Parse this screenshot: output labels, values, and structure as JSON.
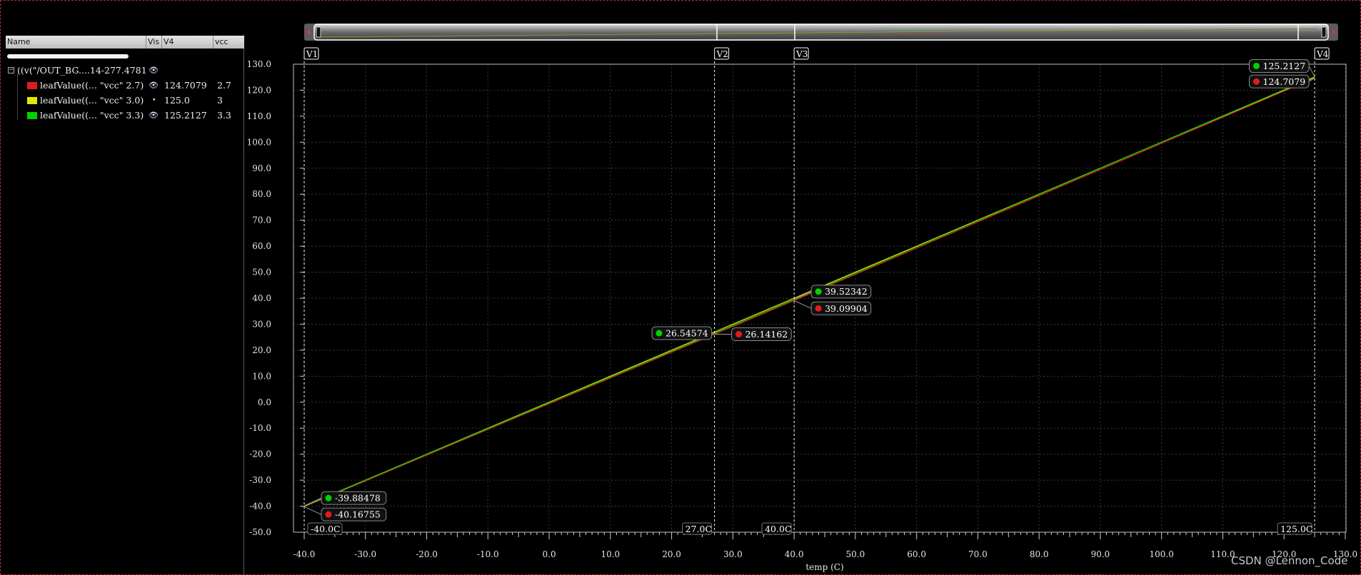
{
  "browser": {
    "columns": [
      "Name",
      "Vis",
      "V4",
      "vcc"
    ],
    "root": {
      "name": "((v(\"/OUT_BG....14-277.4781",
      "expander": "−"
    },
    "leaves": [
      {
        "name": "leafValue((... \"vcc\" 2.7)",
        "v4": "124.7079",
        "vcc": "2.7",
        "color": "#e41a1c",
        "vis": "eye"
      },
      {
        "name": "leafValue((... \"vcc\" 3.0)",
        "v4": "125.0",
        "vcc": "3",
        "color": "#e6e600",
        "vis": "dot"
      },
      {
        "name": "leafValue((... \"vcc\" 3.3)",
        "v4": "125.2127",
        "vcc": "3.3",
        "color": "#00d200",
        "vis": "eye"
      }
    ]
  },
  "cursors": [
    {
      "name": "V1",
      "x": -40.0,
      "readout": "-40.0C"
    },
    {
      "name": "V2",
      "x": 27.0,
      "readout": "27.0C"
    },
    {
      "name": "V3",
      "x": 40.0,
      "readout": "40.0C"
    },
    {
      "name": "V4",
      "x": 125.0,
      "readout": "125.0C"
    }
  ],
  "markers": [
    {
      "label": "-39.88478",
      "color": "#00d200",
      "x": -40.0,
      "y": -39.88478,
      "side": "right-up"
    },
    {
      "label": "-40.16755",
      "color": "#e41a1c",
      "x": -40.0,
      "y": -40.16755,
      "side": "right-down"
    },
    {
      "label": "26.54574",
      "color": "#00d200",
      "x": 27.0,
      "y": 26.54574,
      "side": "left"
    },
    {
      "label": "26.14162",
      "color": "#e41a1c",
      "x": 27.0,
      "y": 26.14162,
      "side": "right"
    },
    {
      "label": "39.52342",
      "color": "#00d200",
      "x": 40.0,
      "y": 39.52342,
      "side": "right-up"
    },
    {
      "label": "39.09904",
      "color": "#e41a1c",
      "x": 40.0,
      "y": 39.09904,
      "side": "right-down"
    },
    {
      "label": "125.2127",
      "color": "#00d200",
      "x": 125.0,
      "y": 125.2127,
      "side": "left-up"
    },
    {
      "label": "124.7079",
      "color": "#e41a1c",
      "x": 125.0,
      "y": 124.7079,
      "side": "left-down"
    }
  ],
  "chart_data": {
    "type": "line",
    "title": "",
    "xlabel": "temp (C)",
    "ylabel": "",
    "xlim": [
      -40.0,
      130.0
    ],
    "ylim": [
      -50.0,
      130.0
    ],
    "xticks": [
      -40.0,
      -30.0,
      -20.0,
      -10.0,
      0.0,
      10.0,
      20.0,
      30.0,
      40.0,
      50.0,
      60.0,
      70.0,
      80.0,
      90.0,
      100.0,
      110.0,
      120.0,
      130.0
    ],
    "yticks": [
      -50.0,
      -40.0,
      -30.0,
      -20.0,
      -10.0,
      0.0,
      10.0,
      20.0,
      30.0,
      40.0,
      50.0,
      60.0,
      70.0,
      80.0,
      90.0,
      100.0,
      110.0,
      120.0,
      130.0
    ],
    "xtick_labels": [
      "-40.0",
      "-30.0",
      "-20.0",
      "-10.0",
      "0.0",
      "10.0",
      "20.0",
      "30.0",
      "40.0",
      "50.0",
      "60.0",
      "70.0",
      "80.0",
      "90.0",
      "100.0",
      "110.0",
      "120.0",
      "130.0"
    ],
    "ytick_labels": [
      "-50.0",
      "-40.0",
      "-30.0",
      "-20.0",
      "-10.0",
      "0.0",
      "10.0",
      "20.0",
      "30.0",
      "40.0",
      "50.0",
      "60.0",
      "70.0",
      "80.0",
      "90.0",
      "100.0",
      "110.0",
      "120.0",
      "130.0"
    ],
    "grid": true,
    "series": [
      {
        "name": "leafValue((... \"vcc\" 2.7)",
        "color": "#e41a1c",
        "x": [
          -40.0,
          27.0,
          40.0,
          125.0
        ],
        "y": [
          -40.16755,
          26.14162,
          39.09904,
          124.7079
        ]
      },
      {
        "name": "leafValue((... \"vcc\" 3.0)",
        "color": "#e6e600",
        "x": [
          -40.0,
          125.0
        ],
        "y": [
          -40.0,
          125.0
        ]
      },
      {
        "name": "leafValue((... \"vcc\" 3.3)",
        "color": "#00d200",
        "x": [
          -40.0,
          27.0,
          40.0,
          125.0
        ],
        "y": [
          -39.88478,
          26.54574,
          39.52342,
          125.2127
        ]
      }
    ]
  },
  "watermark": "CSDN @Lennon_Code"
}
